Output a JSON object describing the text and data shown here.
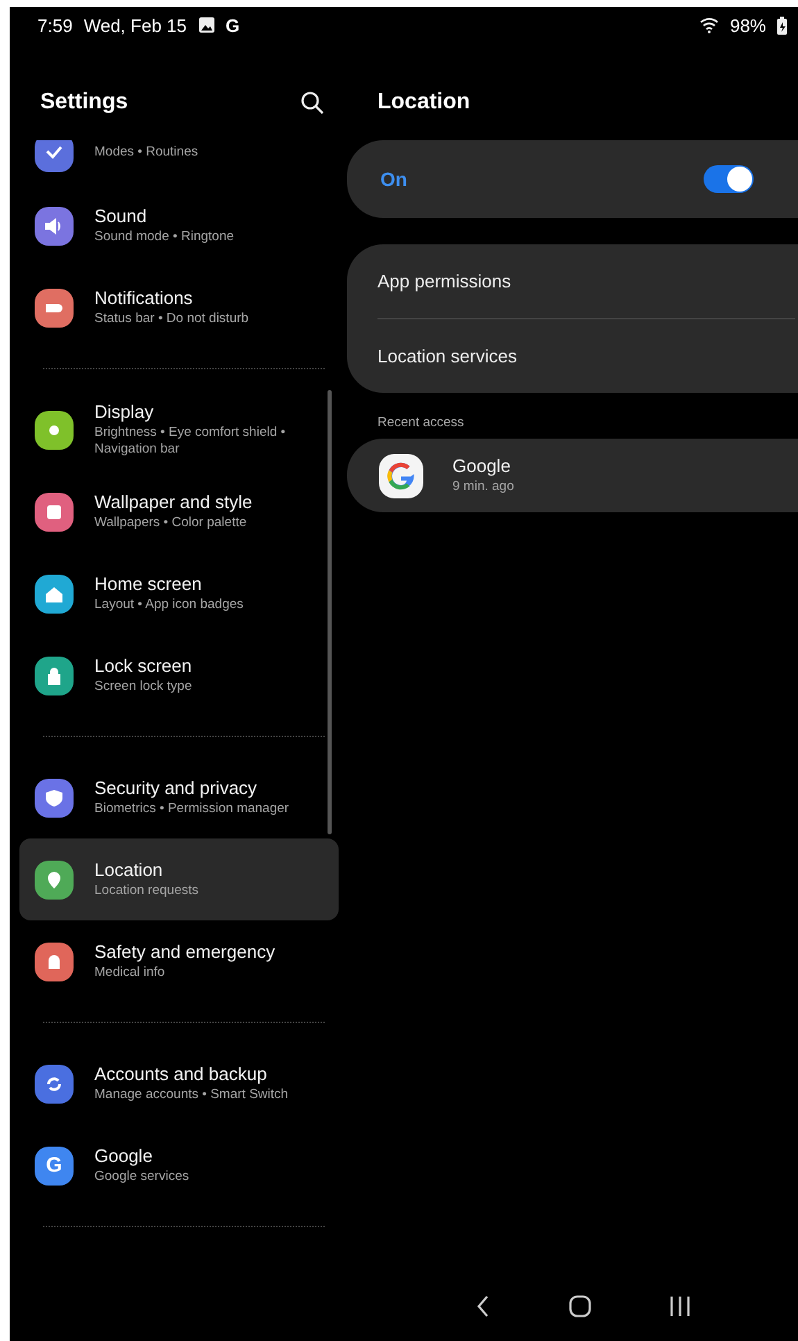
{
  "status_bar": {
    "time": "7:59",
    "date": "Wed, Feb 15",
    "notification_g": "G",
    "battery": "98%"
  },
  "sidebar": {
    "title": "Settings",
    "groups": [
      {
        "items": [
          {
            "kind": "cut",
            "subtitle": "Modes • Routines",
            "color": "#5b6fdc",
            "selected": false
          },
          {
            "kind": "item",
            "title": "Sound",
            "subtitle": "Sound mode • Ringtone",
            "color": "#7b74e0",
            "selected": false
          },
          {
            "kind": "item",
            "title": "Notifications",
            "subtitle": "Status bar • Do not disturb",
            "color": "#e06e62",
            "selected": false
          }
        ]
      },
      {
        "items": [
          {
            "kind": "item",
            "title": "Display",
            "subtitle": "Brightness • Eye comfort shield • Navigation bar",
            "color": "#7fc12a",
            "selected": false
          },
          {
            "kind": "item",
            "title": "Wallpaper and style",
            "subtitle": "Wallpapers • Color palette",
            "color": "#e0607f",
            "selected": false
          },
          {
            "kind": "item",
            "title": "Home screen",
            "subtitle": "Layout • App icon badges",
            "color": "#20a9d4",
            "selected": false
          },
          {
            "kind": "item",
            "title": "Lock screen",
            "subtitle": "Screen lock type",
            "color": "#1fa58a",
            "selected": false
          }
        ]
      },
      {
        "items": [
          {
            "kind": "item",
            "title": "Security and privacy",
            "subtitle": "Biometrics • Permission manager",
            "color": "#6a72e6",
            "selected": false
          },
          {
            "kind": "item",
            "title": "Location",
            "subtitle": "Location requests",
            "color": "#4faa57",
            "selected": true
          },
          {
            "kind": "item",
            "title": "Safety and emergency",
            "subtitle": "Medical info",
            "color": "#e0665a",
            "selected": false
          }
        ]
      },
      {
        "items": [
          {
            "kind": "item",
            "title": "Accounts and backup",
            "subtitle": "Manage accounts • Smart Switch",
            "color": "#4a6fe0",
            "selected": false
          },
          {
            "kind": "item",
            "title": "Google",
            "subtitle": "Google services",
            "color": "#3f86f0",
            "selected": false,
            "letter": "G"
          }
        ]
      }
    ]
  },
  "detail": {
    "title": "Location",
    "master": {
      "label": "On",
      "on": true
    },
    "menu": [
      "App permissions",
      "Location services"
    ],
    "recent_access": {
      "heading": "Recent access",
      "apps": [
        {
          "name": "Google",
          "time": "9 min. ago"
        }
      ]
    }
  }
}
